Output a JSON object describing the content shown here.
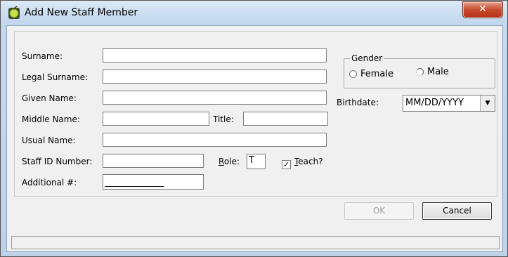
{
  "window": {
    "title": "Add New Staff Member",
    "close_glyph": "✕"
  },
  "labels": {
    "surname": "Surname:",
    "legal_surname": "Legal Surname:",
    "given_name": "Given Name:",
    "middle_name": "Middle Name:",
    "title": "Title:",
    "usual_name": "Usual Name:",
    "staff_id": "Staff ID Number:",
    "role_r": "R",
    "role_rest": "ole:",
    "teach_t": "T",
    "teach_rest": "each?",
    "additional": "Additional #:",
    "gender": "Gender",
    "female": "Female",
    "male": "Male",
    "birthdate": "Birthdate:"
  },
  "values": {
    "role": "T",
    "birthdate": "MM/DD/YYYY",
    "teach_checked": "✓",
    "additional_value": ""
  },
  "buttons": {
    "ok": "OK",
    "cancel": "Cancel"
  },
  "icons": {
    "app": "app-icon",
    "close": "close-icon",
    "dropdown": "chevron-down-icon"
  },
  "dropdown_glyph": "▼"
}
